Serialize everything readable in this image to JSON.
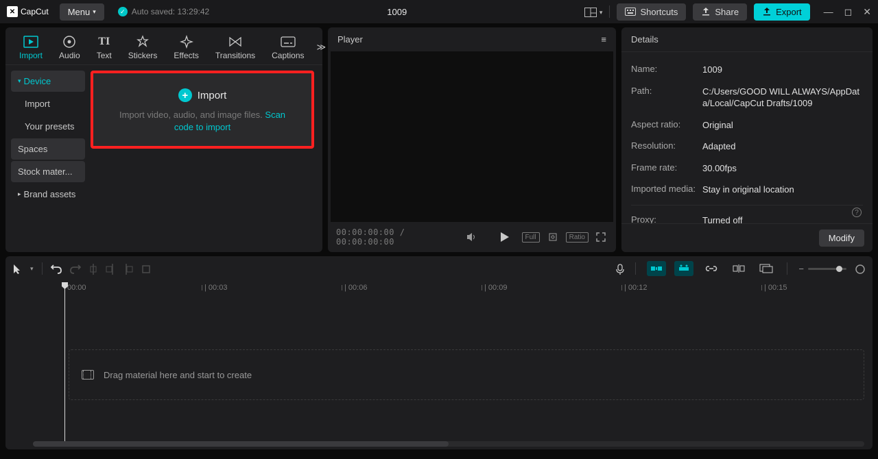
{
  "titlebar": {
    "app_name": "CapCut",
    "menu_label": "Menu",
    "autosave": "Auto saved: 13:29:42",
    "project_title": "1009",
    "shortcuts_label": "Shortcuts",
    "share_label": "Share",
    "export_label": "Export"
  },
  "media_tabs": [
    {
      "label": "Import",
      "active": true
    },
    {
      "label": "Audio"
    },
    {
      "label": "Text"
    },
    {
      "label": "Stickers"
    },
    {
      "label": "Effects"
    },
    {
      "label": "Transitions"
    },
    {
      "label": "Captions"
    }
  ],
  "media_sidebar": [
    {
      "label": "Device",
      "active": true,
      "arrow": true
    },
    {
      "label": "Import"
    },
    {
      "label": "Your presets"
    },
    {
      "label": "Spaces",
      "bg": true
    },
    {
      "label": "Stock mater...",
      "bg": true
    },
    {
      "label": "Brand assets",
      "arrow": true
    }
  ],
  "import_box": {
    "title": "Import",
    "desc_prefix": "Import video, audio, and image files. ",
    "desc_link": "Scan code to import"
  },
  "player": {
    "header": "Player",
    "time": "00:00:00:00 / 00:00:00:00",
    "full_label": "Full",
    "ratio_label": "Ratio"
  },
  "details": {
    "header": "Details",
    "rows": {
      "name_l": "Name:",
      "name_v": "1009",
      "path_l": "Path:",
      "path_v": "C:/Users/GOOD WILL ALWAYS/AppData/Local/CapCut Drafts/1009",
      "ar_l": "Aspect ratio:",
      "ar_v": "Original",
      "res_l": "Resolution:",
      "res_v": "Adapted",
      "fr_l": "Frame rate:",
      "fr_v": "30.00fps",
      "im_l": "Imported media:",
      "im_v": "Stay in original location",
      "proxy_l": "Proxy:",
      "proxy_v": "Turned off"
    },
    "modify_label": "Modify"
  },
  "timeline": {
    "ticks": [
      "00:00",
      "| 00:03",
      "| 00:06",
      "| 00:09",
      "| 00:12",
      "| 00:15"
    ],
    "drop_hint": "Drag material here and start to create"
  }
}
